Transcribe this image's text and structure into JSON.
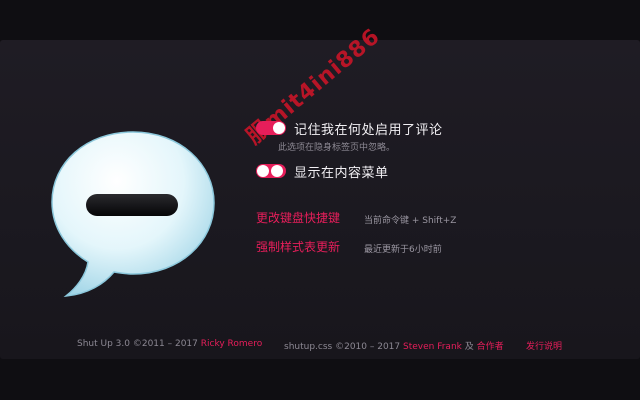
{
  "app": {
    "name": "Shut Up"
  },
  "colors": {
    "accent": "#e61e5a",
    "background": "#1c1a21",
    "text": "#f2f0f4",
    "muted": "#8c8893"
  },
  "icons": {
    "logo": "speech-bubble-minus-icon"
  },
  "settings": {
    "remember": {
      "label": "记住我在何处启用了评论",
      "hint": "此选项在隐身标签页中忽略。",
      "enabled": true
    },
    "context_menu": {
      "label": "显示在内容菜单",
      "enabled": true
    },
    "shortcut": {
      "link": "更改键盘快捷键",
      "info": "当前命令键 + Shift+Z"
    },
    "stylesheet": {
      "link": "强制样式表更新",
      "info": "最近更新于6小时前"
    }
  },
  "watermark": {
    "text": "服mit4ini886"
  },
  "footer": {
    "app_credit": "Shut Up 3.0 ©2011 – 2017",
    "app_author": "Ricky Romero",
    "css_credit": "shutup.css ©2010 – 2017",
    "css_author": "Steven Frank",
    "and": "及",
    "contributors": "合作者",
    "release_notes": "发行说明"
  }
}
